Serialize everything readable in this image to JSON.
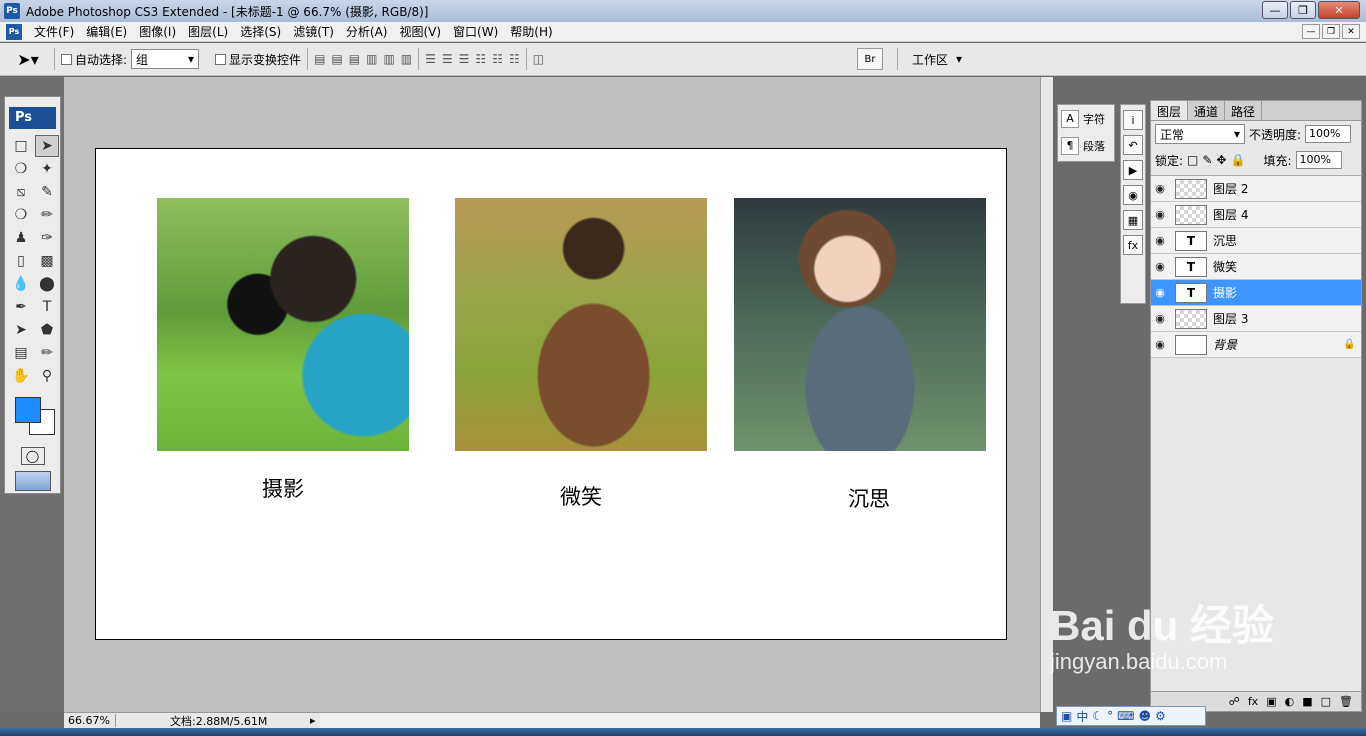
{
  "window": {
    "title": "Adobe Photoshop CS3 Extended - [未标题-1 @ 66.7% (摄影, RGB/8)]",
    "app_icon": "Ps",
    "controls": [
      "minimize",
      "maximize",
      "close"
    ]
  },
  "menu": {
    "items": [
      "文件(F)",
      "编辑(E)",
      "图像(I)",
      "图层(L)",
      "选择(S)",
      "滤镜(T)",
      "分析(A)",
      "视图(V)",
      "窗口(W)",
      "帮助(H)"
    ]
  },
  "options_bar": {
    "auto_select_label": "自动选择:",
    "auto_select_value": "组",
    "show_transform_label": "显示变换控件",
    "workspace_label": "工作区"
  },
  "toolbox": {
    "logo": "Ps",
    "foreground_color": "#1f8dff",
    "background_color": "#ffffff"
  },
  "canvas": {
    "captions": [
      "摄影",
      "微笑",
      "沉思"
    ]
  },
  "status": {
    "zoom": "66.67%",
    "doc_info": "文档:2.88M/5.61M"
  },
  "char_panel": {
    "character_label": "字符",
    "paragraph_label": "段落"
  },
  "layers_panel": {
    "tabs": [
      "图层",
      "通道",
      "路径"
    ],
    "blend_mode": "正常",
    "opacity_label": "不透明度:",
    "opacity_value": "100%",
    "lock_label": "锁定:",
    "fill_label": "填充:",
    "fill_value": "100%",
    "layers": [
      {
        "name": "图层 2",
        "type": "image",
        "selected": false
      },
      {
        "name": "图层 4",
        "type": "image",
        "selected": false
      },
      {
        "name": "沉思",
        "type": "text",
        "selected": false
      },
      {
        "name": "微笑",
        "type": "text",
        "selected": false
      },
      {
        "name": "摄影",
        "type": "text",
        "selected": true
      },
      {
        "name": "图层 3",
        "type": "image",
        "selected": false
      },
      {
        "name": "背景",
        "type": "background",
        "selected": false,
        "locked": true
      }
    ]
  },
  "ime_bar": {
    "label": "中"
  },
  "watermark": {
    "brand": "Bai du 经验",
    "url": "jingyan.baidu.com"
  }
}
